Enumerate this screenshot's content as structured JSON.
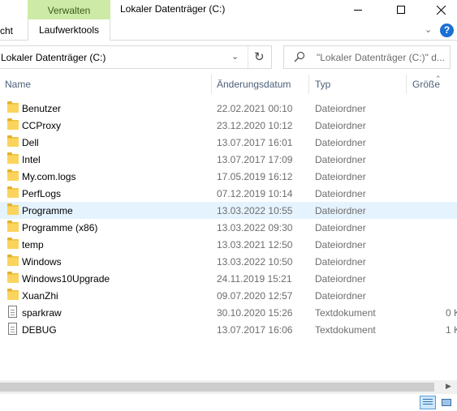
{
  "window": {
    "title": "Lokaler Datenträger (C:)",
    "context_tab_header": "Verwalten",
    "accent_color": "#cdeba7"
  },
  "ribbon": {
    "tabs": [
      {
        "label": "cht"
      },
      {
        "label": "Laufwerktools"
      }
    ],
    "help_label": "?"
  },
  "address": {
    "path": "Lokaler Datenträger (C:)"
  },
  "search": {
    "placeholder": "\"Lokaler Datenträger (C:)\" d..."
  },
  "columns": {
    "name": "Name",
    "date": "Änderungsdatum",
    "type": "Typ",
    "size": "Größe"
  },
  "files": [
    {
      "name": "Benutzer",
      "date": "22.02.2021 00:10",
      "type": "Dateiordner",
      "size": "",
      "icon": "folder-icon"
    },
    {
      "name": "CCProxy",
      "date": "23.12.2020 10:12",
      "type": "Dateiordner",
      "size": "",
      "icon": "folder-icon"
    },
    {
      "name": "Dell",
      "date": "13.07.2017 16:01",
      "type": "Dateiordner",
      "size": "",
      "icon": "folder-icon"
    },
    {
      "name": "Intel",
      "date": "13.07.2017 17:09",
      "type": "Dateiordner",
      "size": "",
      "icon": "folder-icon"
    },
    {
      "name": "My.com.logs",
      "date": "17.05.2019 16:12",
      "type": "Dateiordner",
      "size": "",
      "icon": "folder-icon"
    },
    {
      "name": "PerfLogs",
      "date": "07.12.2019 10:14",
      "type": "Dateiordner",
      "size": "",
      "icon": "folder-icon"
    },
    {
      "name": "Programme",
      "date": "13.03.2022 10:55",
      "type": "Dateiordner",
      "size": "",
      "icon": "folder-icon",
      "selected": true
    },
    {
      "name": "Programme (x86)",
      "date": "13.03.2022 09:30",
      "type": "Dateiordner",
      "size": "",
      "icon": "folder-icon"
    },
    {
      "name": "temp",
      "date": "13.03.2021 12:50",
      "type": "Dateiordner",
      "size": "",
      "icon": "folder-icon"
    },
    {
      "name": "Windows",
      "date": "13.03.2022 10:50",
      "type": "Dateiordner",
      "size": "",
      "icon": "folder-icon"
    },
    {
      "name": "Windows10Upgrade",
      "date": "24.11.2019 15:21",
      "type": "Dateiordner",
      "size": "",
      "icon": "folder-icon"
    },
    {
      "name": "XuanZhi",
      "date": "09.07.2020 12:57",
      "type": "Dateiordner",
      "size": "",
      "icon": "folder-icon"
    },
    {
      "name": "sparkraw",
      "date": "30.10.2020 15:26",
      "type": "Textdokument",
      "size": "0 K",
      "icon": "text-document-icon"
    },
    {
      "name": "DEBUG",
      "date": "13.07.2017 16:06",
      "type": "Textdokument",
      "size": "1 K",
      "icon": "text-document-icon"
    }
  ]
}
